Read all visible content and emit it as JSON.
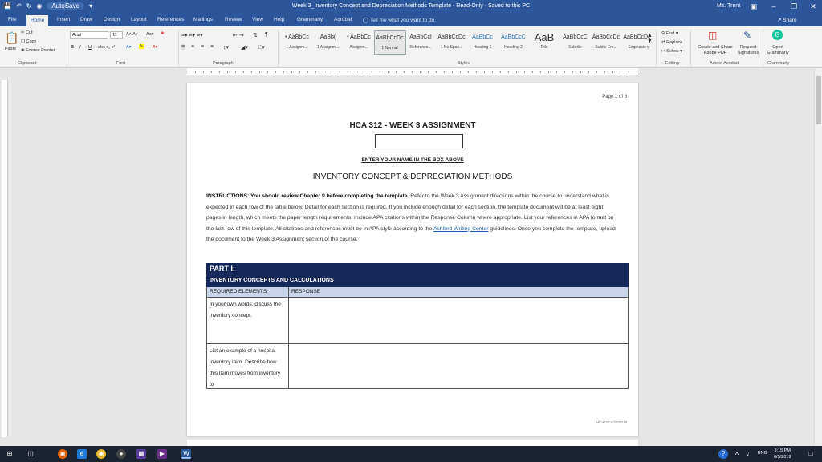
{
  "window": {
    "title": "Week 3_Inventory Concept and Depreciation Methods Template - Read-Only - Saved to this PC",
    "autosave_label": "AutoSave",
    "user": "Ms. Trent"
  },
  "tabs": [
    "File",
    "Home",
    "Insert",
    "Draw",
    "Design",
    "Layout",
    "References",
    "Mailings",
    "Review",
    "View",
    "Help",
    "Grammarly",
    "Acrobat"
  ],
  "tell_me": "Tell me what you want to do",
  "share": "Share",
  "ribbon": {
    "clipboard": {
      "paste": "Paste",
      "cut": "Cut",
      "copy": "Copy",
      "format_painter": "Format Painter",
      "label": "Clipboard"
    },
    "font": {
      "name": "Arial",
      "size": "11",
      "label": "Font"
    },
    "paragraph": {
      "label": "Paragraph"
    },
    "styles": {
      "label": "Styles",
      "items": [
        {
          "sample": "• AaBbCc",
          "name": "1 Assignm..."
        },
        {
          "sample": "AaBb(",
          "name": "1 Assignm..."
        },
        {
          "sample": "• AaBbCc",
          "name": "Assignm..."
        },
        {
          "sample": "AaBbCcDc",
          "name": "1 Normal"
        },
        {
          "sample": "AaBbCcI",
          "name": "Reference..."
        },
        {
          "sample": "AaBbCcDc",
          "name": "1 No Spac..."
        },
        {
          "sample": "AaBbCc",
          "name": "Heading 1"
        },
        {
          "sample": "AaBbCcC",
          "name": "Heading 2"
        },
        {
          "sample": "AaB",
          "name": "Title"
        },
        {
          "sample": "AaBbCcC",
          "name": "Subtitle"
        },
        {
          "sample": "AaBbCcDc",
          "name": "Subtle Em..."
        },
        {
          "sample": "AaBbCcDc",
          "name": "Emphasis"
        }
      ]
    },
    "editing": {
      "find": "Find",
      "replace": "Replace",
      "select": "Select",
      "label": "Editing"
    },
    "adobe": {
      "create_share": "Create and Share Adobe PDF",
      "request_sign": "Request Signatures",
      "label": "Adobe Acrobat"
    },
    "grammarly": {
      "open": "Open Grammarly",
      "label": "Grammarly"
    }
  },
  "document": {
    "page_number": "Page 1 of 8",
    "heading": "HCA 312 - WEEK 3 ASSIGNMENT",
    "name_caption": "ENTER YOUR NAME IN THE BOX ABOVE",
    "subtitle": "INVENTORY CONCEPT & DEPRECIATION METHODS",
    "instructions_bold": "INSTRUCTIONS:  You should review Chapter 9 before completing the template.",
    "instructions_text": " Refer to the Week 3 Assignment directions within the course to understand what is expected in each row of the table below. Detail for each section is required. If you include enough detail for each section, the template document will be at least eight pages in length, which meets the paper length requirements. Include APA citations within the Response Column where appropriate. List your references in APA format on the last row of this template. All citations and references must be in APA style according to the ",
    "instructions_link": "Ashford Writing Center",
    "instructions_tail": " guidelines. Once you complete the template, upload the document to the Week 3 Assignment section of the course.",
    "table": {
      "part_title": "PART I:",
      "part_subtitle": "INVENTORY CONCEPTS AND CALCULATIONS",
      "col_required": "REQUIRED ELEMENTS",
      "col_response": "RESPONSE",
      "rows": [
        "In your own words, discuss the inventory concept.",
        "List an example of a hospital inventory item. Describe how this item moves from inventory to"
      ]
    },
    "footer_stamp": "HCA312 6/12/2018"
  },
  "taskbar": {
    "language": "ENG",
    "time": "3:15 PM",
    "date": "6/5/2019"
  }
}
